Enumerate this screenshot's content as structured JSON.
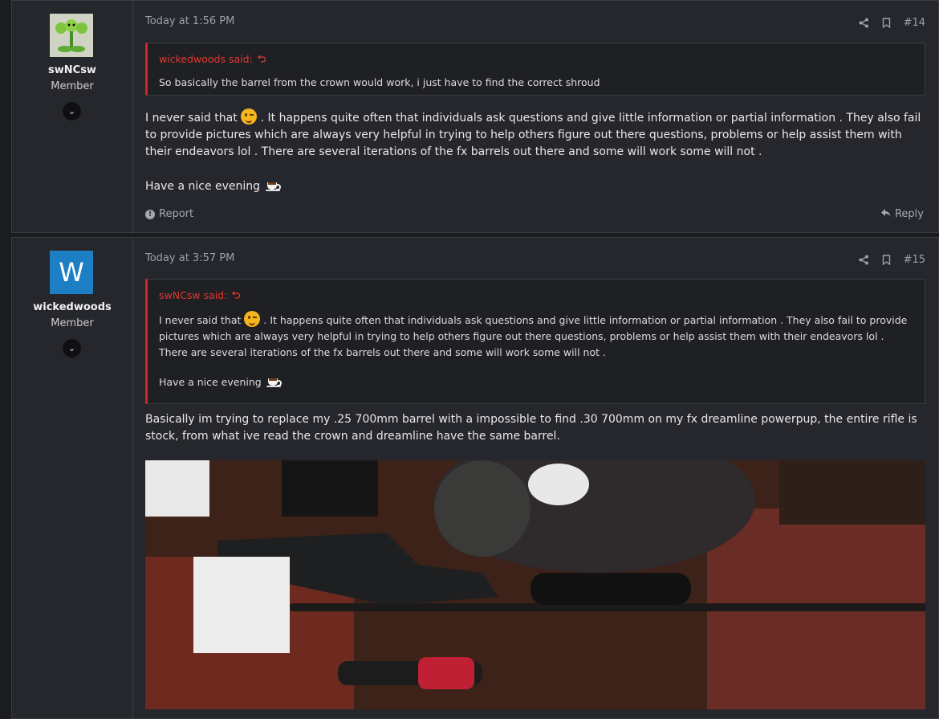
{
  "posts": [
    {
      "author": "swNCsw",
      "role": "Member",
      "time": "Today at 1:56 PM",
      "number": "#14",
      "quote": {
        "author_label": "wickedwoods said:",
        "lines": [
          "So basically the barrel from the crown would work, i just have to find the correct shroud"
        ]
      },
      "body": {
        "p1_prefix": "I never said that",
        "p1_rest": ". It happens quite often that individuals ask questions and give little information or partial information . They also fail to provide pictures which are always very helpful in trying to help others figure out there questions, problems or help assist them with their endeavors lol . There are several iterations of the fx barrels out there and some will work some will not .",
        "p2": "Have a nice evening"
      },
      "actions": {
        "report": "Report",
        "reply": "Reply"
      }
    },
    {
      "author": "wickedwoods",
      "avatar_letter": "W",
      "role": "Member",
      "time": "Today at 3:57 PM",
      "number": "#15",
      "quote": {
        "author_label": "swNCsw said:",
        "p1_prefix": "I never said that",
        "p1_rest": ". It happens quite often that individuals ask questions and give little information or partial information . They also fail to provide pictures which are always very helpful in trying to help others figure out there questions, problems or help assist them with their endeavors lol . There are several iterations of the fx barrels out there and some will work some will not .",
        "p2": "Have a nice evening"
      },
      "body": {
        "p1": "Basically im trying to replace my .25 700mm barrel with a impossible to find .30 700mm on my fx dreamline powerpup, the entire rifle is stock, from what ive read the crown and dreamline have the same barrel."
      }
    }
  ],
  "colors": {
    "page_bg": "#1b1c20",
    "post_bg": "#26272c",
    "quote_accent": "#d42626",
    "quote_author": "#e0382f",
    "avatar_blue": "#1d7fc3"
  },
  "icons": [
    "plant-avatar",
    "chevron-down-icon",
    "share-icon",
    "bookmark-icon",
    "undo-arrow-icon",
    "wink-emoji",
    "coffee-emoji",
    "report-icon",
    "reply-icon"
  ]
}
